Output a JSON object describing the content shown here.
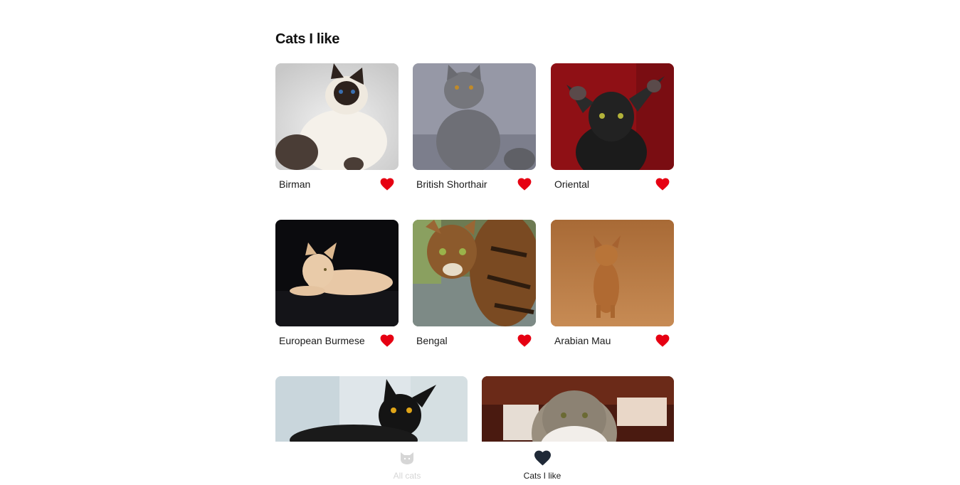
{
  "page": {
    "title": "Cats I like"
  },
  "cats": [
    {
      "name": "Birman",
      "liked": true
    },
    {
      "name": "British Shorthair",
      "liked": true
    },
    {
      "name": "Oriental",
      "liked": true
    },
    {
      "name": "European Burmese",
      "liked": true
    },
    {
      "name": "Bengal",
      "liked": true
    },
    {
      "name": "Arabian Mau",
      "liked": true
    }
  ],
  "partial_cats": [
    {
      "description": "black cat photo"
    },
    {
      "description": "exotic shorthair photo"
    }
  ],
  "tabbar": {
    "tabs": [
      {
        "label": "All cats",
        "icon": "cat-icon",
        "active": false
      },
      {
        "label": "Cats I like",
        "icon": "heart-icon",
        "active": true
      }
    ]
  },
  "colors": {
    "heart": "#e60012",
    "active_icon": "#1f2937",
    "inactive": "#d6d6d6"
  }
}
